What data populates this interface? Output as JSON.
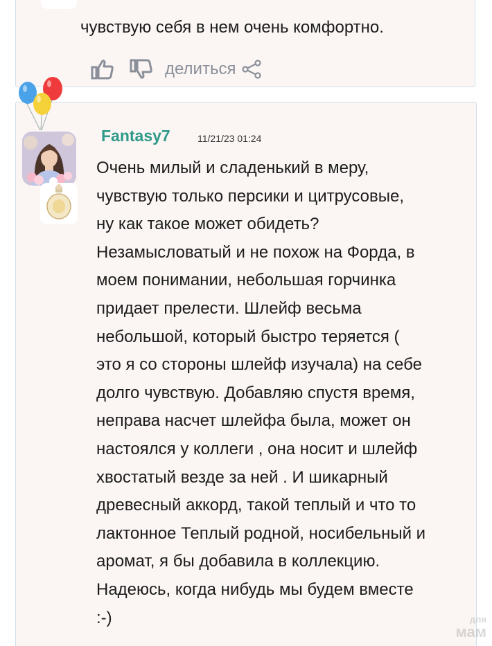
{
  "previous_comment": {
    "last_line": "чувствую себя в нем очень комфортно.",
    "like_icon": "thumbs-up-icon",
    "dislike_icon": "thumbs-down-icon",
    "share_label": "делиться",
    "share_icon": "share-icon"
  },
  "comment": {
    "author": "Fantasy7",
    "timestamp": "11/21/23 01:24",
    "avatar_icon": "user-avatar",
    "badge_icon": "perfume-bottle-badge",
    "decoration_icon": "balloons-icon",
    "lines": [
      "Очень милый и сладенький в меру,",
      "чувствую только персики и цитрусовые,",
      "ну как такое может обидеть?",
      "Незамысловатый и не похож на Форда, в",
      "моем понимании, небольшая горчинка",
      "придает прелести. Шлейф весьма",
      "небольшой, который быстро теряется (",
      "это я со стороны шлейф изучала) на себе",
      "долго чувствую. Добавляю спустя время,",
      "неправа насчет шлейфа была, может он",
      "настоялся у коллеги , она носит и шлейф",
      "хвостатый везде за ней . И шикарный",
      "древесный аккорд, такой теплый и что то",
      "лактонное Теплый родной, носибельный и",
      "аромат, я бы добавила в коллекцию.",
      "Надеюсь, когда нибудь мы будем вместе",
      ":-)"
    ]
  },
  "watermark": {
    "line1": "для",
    "line2": "мам"
  },
  "colors": {
    "card_background": "#fbf6f4",
    "card_border": "#cfe0ec",
    "username": "#2f9a8a",
    "action_gray": "#8a8f99",
    "text": "#1c1c1c"
  }
}
